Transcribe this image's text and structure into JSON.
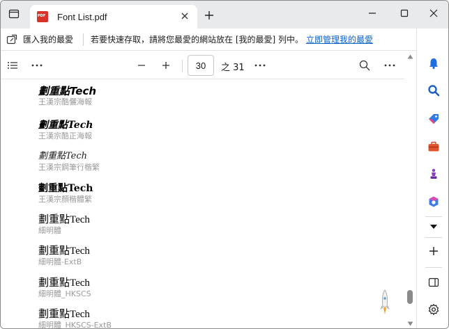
{
  "tab": {
    "title": "Font List.pdf"
  },
  "favorites_bar": {
    "import_label": "匯入我的最愛",
    "message": "若要快速存取，請將您最愛的網站放在 [我的最愛] 列中。",
    "manage_link": "立即管理我的最愛"
  },
  "pdf_toolbar": {
    "current_page": "30",
    "total_pages": "之 31"
  },
  "fonts": [
    {
      "sample": "劃重點Tech",
      "name": "王漢宗酷儷海報"
    },
    {
      "sample": "劃重點Tech",
      "name": "王漢宗酷正海報"
    },
    {
      "sample": "劃重點Tech",
      "name": "王漢宗鋼筆行楷繁"
    },
    {
      "sample": "劃重點Tech",
      "name": "王漢宗顏楷體繁"
    },
    {
      "sample": "劃重點Tech",
      "name": "細明體"
    },
    {
      "sample": "劃重點Tech",
      "name": "細明體-ExtB"
    },
    {
      "sample": "劃重點Tech",
      "name": "細明體_HKSCS"
    },
    {
      "sample": "劃重點Tech",
      "name": "細明體_HKSCS-ExtB"
    }
  ],
  "icons": {
    "window_menu": "tab-actions-icon",
    "close_tab": "close-icon",
    "new_tab": "plus-icon",
    "minimize": "minimize-icon",
    "maximize": "maximize-icon",
    "close_window": "close-icon",
    "sidebar": [
      "bell-icon",
      "search-icon",
      "tag-icon",
      "briefcase-icon",
      "chess-icon",
      "office-icon",
      "chevron-down-icon",
      "plus-icon",
      "sidebar-icon",
      "gear-icon"
    ]
  },
  "colors": {
    "link": "#0a63c9",
    "accent": "#0a63c9",
    "pdf_red": "#d9322a"
  }
}
